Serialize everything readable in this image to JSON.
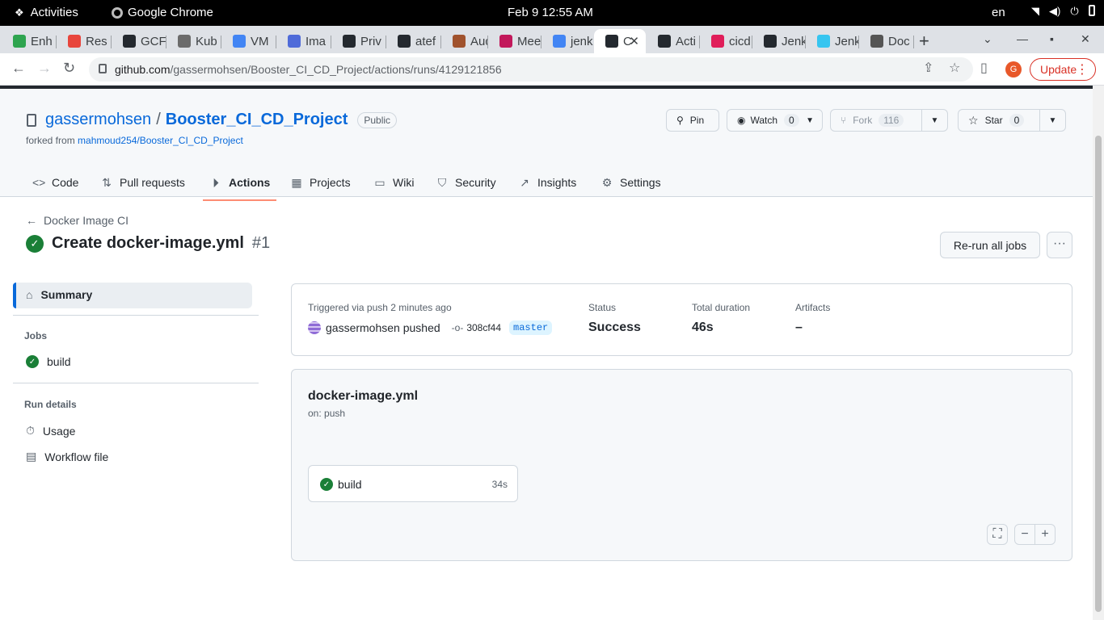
{
  "system": {
    "activities": "Activities",
    "app_name": "Google Chrome",
    "clock": "Feb 9  12:55 AM",
    "lang": "en"
  },
  "tabs": [
    {
      "label": "Enh",
      "color": "#2ea44f"
    },
    {
      "label": "Res",
      "color": "#e8453c"
    },
    {
      "label": "GCF",
      "color": "#24292f"
    },
    {
      "label": "Kub",
      "color": "#6b6b6b"
    },
    {
      "label": "VM",
      "color": "#4285f4"
    },
    {
      "label": "Ima",
      "color": "#4f6bd9"
    },
    {
      "label": "Priv",
      "color": "#24292f"
    },
    {
      "label": "atef",
      "color": "#24292f"
    },
    {
      "label": "Aud",
      "color": "#a0522d"
    },
    {
      "label": "Mee",
      "color": "#c2185b"
    },
    {
      "label": "jenk",
      "color": "#4285f4"
    },
    {
      "label": "C",
      "color": "#24292f"
    },
    {
      "label": "Acti",
      "color": "#24292f"
    },
    {
      "label": "cicd",
      "color": "#e01e5a"
    },
    {
      "label": "Jenk",
      "color": "#24292f"
    },
    {
      "label": "Jenk",
      "color": "#36c5f0"
    },
    {
      "label": "Doc",
      "color": "#555555"
    }
  ],
  "address": {
    "host": "github.com",
    "path": "/gassermohsen/Booster_CI_CD_Project/actions/runs/4129121856",
    "profile_initial": "G",
    "update_label": "Update"
  },
  "repo": {
    "owner": "gassermohsen",
    "slash": "/",
    "name": "Booster_CI_CD_Project",
    "visibility": "Public",
    "forked_prefix": "forked from ",
    "forked_from": "mahmoud254/Booster_CI_CD_Project",
    "pin_label": "Pin",
    "watch_label": "Watch",
    "watch_count": "0",
    "fork_label": "Fork",
    "fork_count": "116",
    "star_label": "Star",
    "star_count": "0"
  },
  "nav": {
    "code": "Code",
    "pulls": "Pull requests",
    "actions": "Actions",
    "projects": "Projects",
    "wiki": "Wiki",
    "security": "Security",
    "insights": "Insights",
    "settings": "Settings"
  },
  "run": {
    "back_label": "Docker Image CI",
    "title": "Create docker-image.yml",
    "number": "#1",
    "rerun_label": "Re-run all jobs"
  },
  "sidebar": {
    "summary": "Summary",
    "jobs_heading": "Jobs",
    "job_build": "build",
    "run_details_heading": "Run details",
    "usage": "Usage",
    "workflow_file": "Workflow file"
  },
  "summary": {
    "trigger": "Triggered via push 2 minutes ago",
    "actor": "gassermohsen pushed",
    "sha": "308cf44",
    "branch": "master",
    "status_label": "Status",
    "status_value": "Success",
    "duration_label": "Total duration",
    "duration_value": "46s",
    "artifacts_label": "Artifacts",
    "artifacts_value": "–"
  },
  "workflow": {
    "file": "docker-image.yml",
    "on": "on: push",
    "job_name": "build",
    "job_duration": "34s"
  }
}
